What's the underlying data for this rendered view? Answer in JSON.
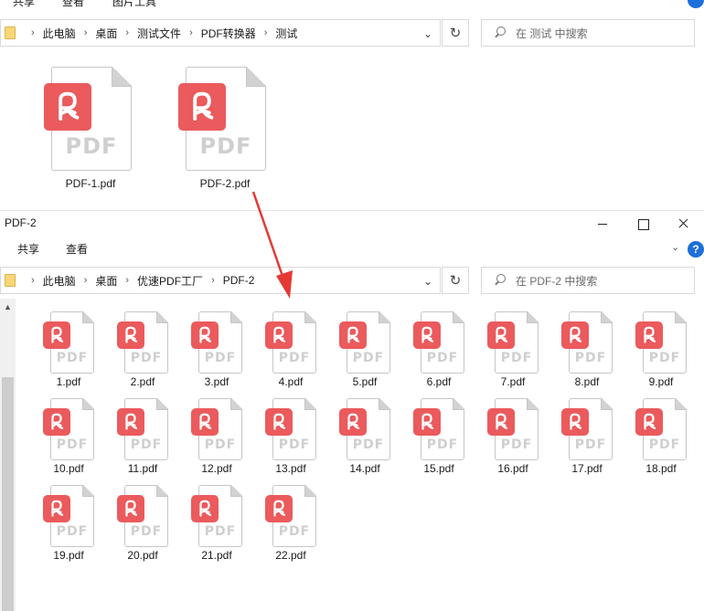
{
  "back_window": {
    "ribbon": {
      "share": "共享",
      "view": "查看",
      "picture_tools": "图片工具"
    },
    "breadcrumb": [
      "此电脑",
      "桌面",
      "测试文件",
      "PDF转换器",
      "测试"
    ],
    "search_placeholder": "在 测试 中搜索",
    "files": [
      "PDF-1.pdf",
      "PDF-2.pdf"
    ]
  },
  "front_window": {
    "title": "PDF-2",
    "ribbon": {
      "share": "共享",
      "view": "查看"
    },
    "help": "?",
    "breadcrumb": [
      "此电脑",
      "桌面",
      "优速PDF工厂",
      "PDF-2"
    ],
    "search_placeholder": "在 PDF-2 中搜索",
    "files": [
      "1.pdf",
      "2.pdf",
      "3.pdf",
      "4.pdf",
      "5.pdf",
      "6.pdf",
      "7.pdf",
      "8.pdf",
      "9.pdf",
      "10.pdf",
      "11.pdf",
      "12.pdf",
      "13.pdf",
      "14.pdf",
      "15.pdf",
      "16.pdf",
      "17.pdf",
      "18.pdf",
      "19.pdf",
      "20.pdf",
      "21.pdf",
      "22.pdf"
    ]
  },
  "icon_text": "PDF",
  "colors": {
    "pdf_red": "#eb5a5c",
    "arrow_red": "#e53935",
    "folder_yellow": "#f8d775",
    "help_blue": "#1e6fd9"
  },
  "icons": [
    "folder-icon",
    "pdf-file-icon",
    "refresh-icon",
    "search-icon",
    "chevron-down-icon",
    "help-icon",
    "red-arrow"
  ]
}
